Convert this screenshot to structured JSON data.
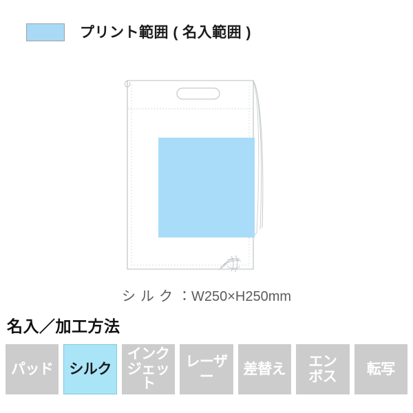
{
  "legend": {
    "swatch_color": "#a9d9f5",
    "swatch_border_color": "#9aa3aa",
    "label": "プリント範囲 ( 名入範囲 )"
  },
  "illustration": {
    "name": "drawstring-bag-diagram",
    "bag_outline_color": "#b9bdc0",
    "seam_line_color": "#cfd3d6",
    "cord_color": "#bfc3c6",
    "print_area": {
      "label": "print-area",
      "fill_color": "#a9dcf8"
    }
  },
  "caption": {
    "method": "シルク",
    "separator": "：",
    "size": "W250×H250mm"
  },
  "section": {
    "heading": "名入／加工方法"
  },
  "methods": {
    "active_color": "#a9e4f7",
    "inactive_color": "#cccccc",
    "items": [
      {
        "label": "パッド",
        "active": false
      },
      {
        "label": "シルク",
        "active": true
      },
      {
        "label": "インク\nジェット",
        "active": false
      },
      {
        "label": "レーザー",
        "active": false
      },
      {
        "label": "差替え",
        "active": false
      },
      {
        "label": "エン\nボス",
        "active": false
      },
      {
        "label": "転写",
        "active": false
      }
    ]
  }
}
